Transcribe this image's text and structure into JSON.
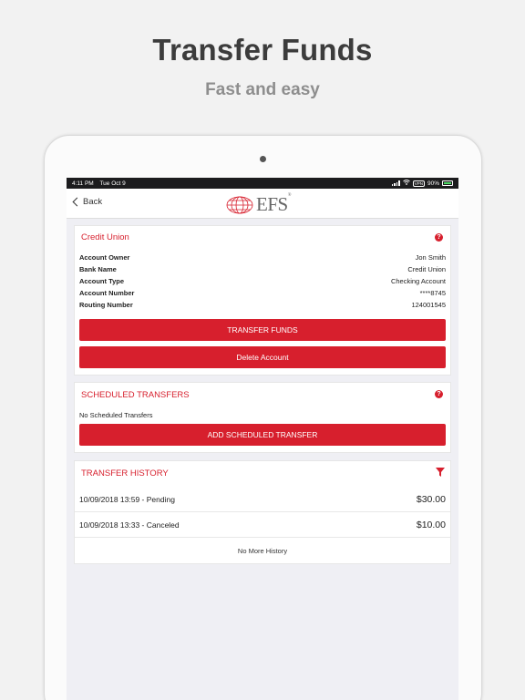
{
  "promo": {
    "headline": "Transfer Funds",
    "subline": "Fast and easy"
  },
  "status_bar": {
    "time": "4:11 PM",
    "date": "Tue Oct 9",
    "battery": "90%",
    "vpn": "VPN"
  },
  "nav": {
    "back_label": "Back",
    "logo_text": "EFS"
  },
  "account_card": {
    "title": "Credit Union",
    "help_icon": "question-circle-icon",
    "rows": [
      {
        "label": "Account Owner",
        "value": "Jon Smith"
      },
      {
        "label": "Bank Name",
        "value": "Credit Union"
      },
      {
        "label": "Account Type",
        "value": "Checking Account"
      },
      {
        "label": "Account Number",
        "value": "****8745"
      },
      {
        "label": "Routing Number",
        "value": "124001545"
      }
    ],
    "transfer_button": "TRANSFER FUNDS",
    "delete_button": "Delete Account"
  },
  "scheduled_card": {
    "title": "SCHEDULED TRANSFERS",
    "help_icon": "question-circle-icon",
    "empty_text": "No Scheduled Transfers",
    "add_button": "ADD SCHEDULED TRANSFER"
  },
  "history_card": {
    "title": "TRANSFER HISTORY",
    "filter_icon": "filter-icon",
    "items": [
      {
        "desc": "10/09/2018 13:59 - Pending",
        "amount": "$30.00"
      },
      {
        "desc": "10/09/2018 13:33 - Canceled",
        "amount": "$10.00"
      }
    ],
    "footer": "No More History"
  },
  "colors": {
    "accent": "#d71f2d",
    "background": "#efeff4",
    "headline": "#3c3c3c",
    "subline": "#8e8e8e"
  }
}
